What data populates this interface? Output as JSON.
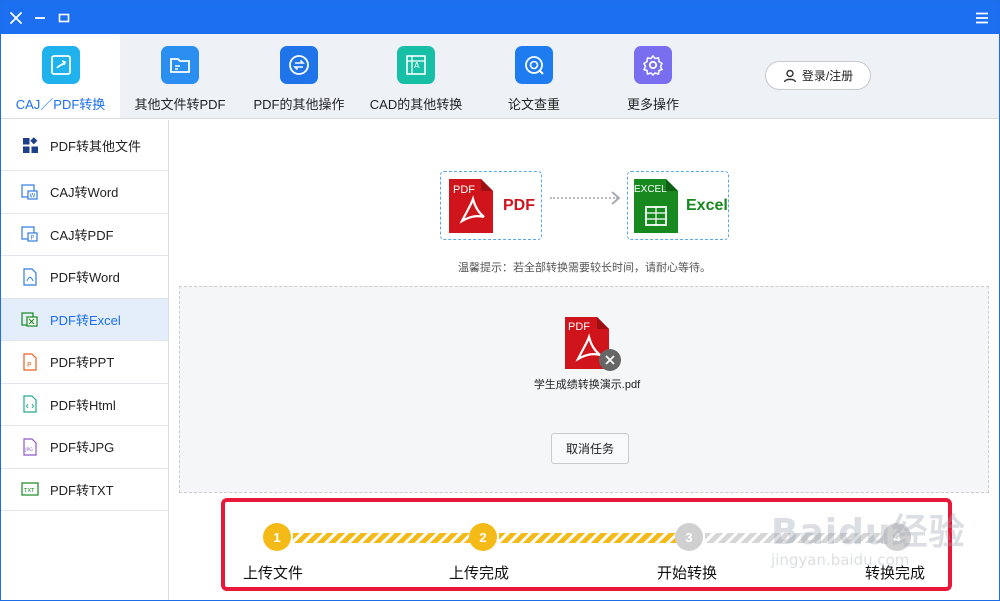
{
  "colors": {
    "brand": "#1c6ff0",
    "accent_yellow": "#f4bb18",
    "highlight_red": "#e8183a",
    "pdf_red": "#d0141c",
    "excel_green": "#17891f"
  },
  "titlebar": {
    "close_icon": "close-icon",
    "minimize_icon": "minimize-icon",
    "maximize_icon": "maximize-icon",
    "menu_icon": "hamburger-menu-icon"
  },
  "toolbar": {
    "tools": [
      {
        "label": "CAJ／PDF转换",
        "icon": "convert-doc-icon",
        "color": "#1fb2ec",
        "active": true
      },
      {
        "label": "其他文件转PDF",
        "icon": "folder-icon",
        "color": "#2a8ff0",
        "active": false
      },
      {
        "label": "PDF的其他操作",
        "icon": "swap-arrows-icon",
        "color": "#1f74ea",
        "active": false
      },
      {
        "label": "CAD的其他转换",
        "icon": "cad-drawing-icon",
        "color": "#18bfa7",
        "active": false
      },
      {
        "label": "论文查重",
        "icon": "search-at-icon",
        "color": "#1e7cf0",
        "active": false
      },
      {
        "label": "更多操作",
        "icon": "gear-icon",
        "color": "#7a6ef0",
        "active": false
      }
    ],
    "login_label": "登录/注册"
  },
  "sidebar": {
    "items": [
      {
        "label": "PDF转其他文件",
        "icon": "grid-apps-icon"
      },
      {
        "label": "CAJ转Word",
        "icon": "caj-word-icon"
      },
      {
        "label": "CAJ转PDF",
        "icon": "caj-pdf-icon"
      },
      {
        "label": "PDF转Word",
        "icon": "pdf-word-icon"
      },
      {
        "label": "PDF转Excel",
        "icon": "pdf-excel-icon",
        "active": true
      },
      {
        "label": "PDF转PPT",
        "icon": "pdf-ppt-icon"
      },
      {
        "label": "PDF转Html",
        "icon": "pdf-html-icon"
      },
      {
        "label": "PDF转JPG",
        "icon": "pdf-jpg-icon"
      },
      {
        "label": "PDF转TXT",
        "icon": "pdf-txt-icon"
      }
    ]
  },
  "main": {
    "from_badge": "PDF",
    "from_label": "PDF",
    "to_badge": "EXCEL",
    "to_label": "Excel",
    "tip": "温馨提示：若全部转换需要较长时间，请耐心等待。",
    "file": {
      "badge": "PDF",
      "name": "学生成绩转换演示.pdf"
    },
    "cancel_label": "取消任务"
  },
  "progress": {
    "steps": [
      {
        "num": "1",
        "label": "上传文件",
        "done": true
      },
      {
        "num": "2",
        "label": "上传完成",
        "done": true
      },
      {
        "num": "3",
        "label": "开始转换",
        "done": false
      },
      {
        "num": "4",
        "label": "转换完成",
        "done": false
      }
    ]
  },
  "watermark": {
    "main": "Baidu经验",
    "sub": "jingyan.baidu.com"
  }
}
